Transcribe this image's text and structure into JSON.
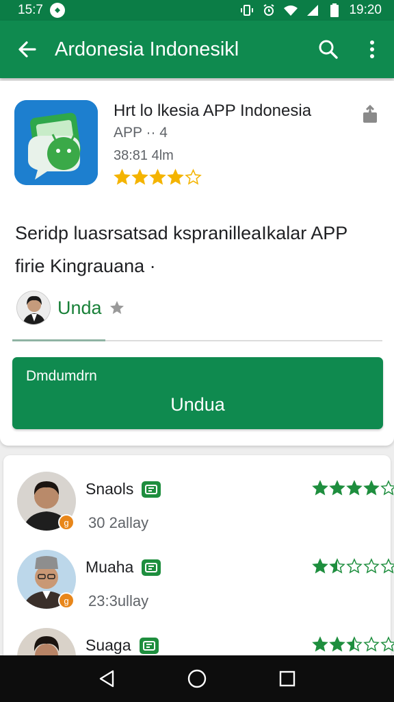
{
  "status_bar": {
    "time_left": "15:7",
    "time_right": "19:20",
    "icons": [
      "notification-icon",
      "vibrate-icon",
      "alarm-icon",
      "wifi-icon",
      "signal-icon",
      "battery-icon"
    ]
  },
  "app_bar": {
    "title": "Ardonesia Indonesikl",
    "icons": [
      "back-arrow-icon",
      "search-icon",
      "more-vert-icon"
    ]
  },
  "app_info": {
    "name": "Hrt lo lkesia APP Indonesia",
    "developer": "APP ·· 4",
    "size": "38:81 4lm",
    "rating": 4,
    "icon": "chat-app-icon"
  },
  "description": {
    "line1": "Seridp luasrsatsad kspranilleaIkalar APP",
    "line2": "firie Kingrauana ·"
  },
  "author": {
    "name": "Unda"
  },
  "install": {
    "top_label": "Dmdumdrn",
    "label": "Undua"
  },
  "reviews": [
    {
      "name": "Snaols",
      "time": "30 2allay",
      "rating": 4,
      "badge": "g"
    },
    {
      "name": "Muaha",
      "time": "23:3ullay",
      "rating": 1.5,
      "badge": "g"
    },
    {
      "name": "Suaga",
      "time": "",
      "rating": 2.5,
      "badge": ""
    }
  ],
  "colors": {
    "primary": "#0f8a4f",
    "status": "#0b7d46",
    "star_gold": "#f4b400",
    "star_green": "#1e8e3e",
    "accent_text": "#188038"
  },
  "nav_bar": {
    "icons": [
      "back-triangle-icon",
      "home-circle-icon",
      "recents-square-icon"
    ]
  }
}
